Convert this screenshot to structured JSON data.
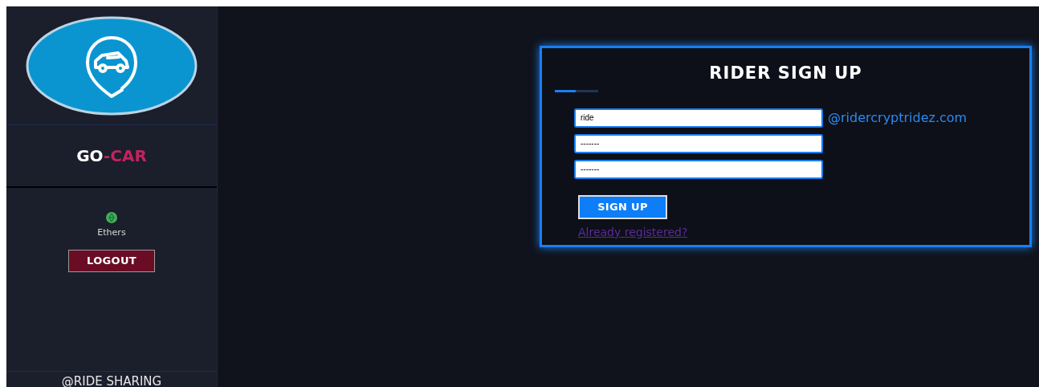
{
  "sidebar": {
    "brand": [
      {
        "text": "GO",
        "color": "#ffffff"
      },
      {
        "text": "-CAR",
        "color": "#c0245e"
      }
    ],
    "balance_label": "Ethers",
    "logout_button": "LOGOUT",
    "footer": "@RIDE SHARING"
  },
  "form": {
    "title": "RIDER SIGN UP",
    "fields": [
      {
        "value": "ride",
        "suffix": "@ridercryptridez.com"
      },
      {
        "value": "-------"
      },
      {
        "value": "-------"
      }
    ],
    "submit_button": "SIGN UP",
    "login_link": "Already registered?"
  }
}
